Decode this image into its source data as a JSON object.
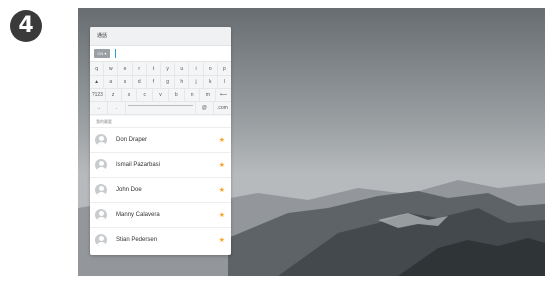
{
  "step_number": "4",
  "panel": {
    "title": "通話",
    "lang_chip": "CN ▾",
    "section_label": "我的最愛"
  },
  "keyboard": {
    "row1": [
      "q",
      "w",
      "e",
      "r",
      "t",
      "y",
      "u",
      "i",
      "o",
      "p"
    ],
    "row2": [
      "▲",
      "a",
      "s",
      "d",
      "f",
      "g",
      "h",
      "j",
      "k",
      "l"
    ],
    "row3": [
      "?123",
      "z",
      "x",
      "c",
      "v",
      "b",
      "n",
      "m",
      "⟵"
    ],
    "row4_left": [
      "→",
      "."
    ],
    "row4_right": [
      "@",
      ".com"
    ]
  },
  "contacts": [
    {
      "name": "Don Draper"
    },
    {
      "name": "Ismail Pazarbasi"
    },
    {
      "name": "John Doe"
    },
    {
      "name": "Manny Calavera"
    },
    {
      "name": "Stian Pedersen"
    }
  ],
  "icons": {
    "favorite": "star-icon",
    "favorite_glyph": "★",
    "avatar": "person-icon"
  },
  "colors": {
    "accent": "#2a9fd8",
    "star": "#f5a623"
  }
}
